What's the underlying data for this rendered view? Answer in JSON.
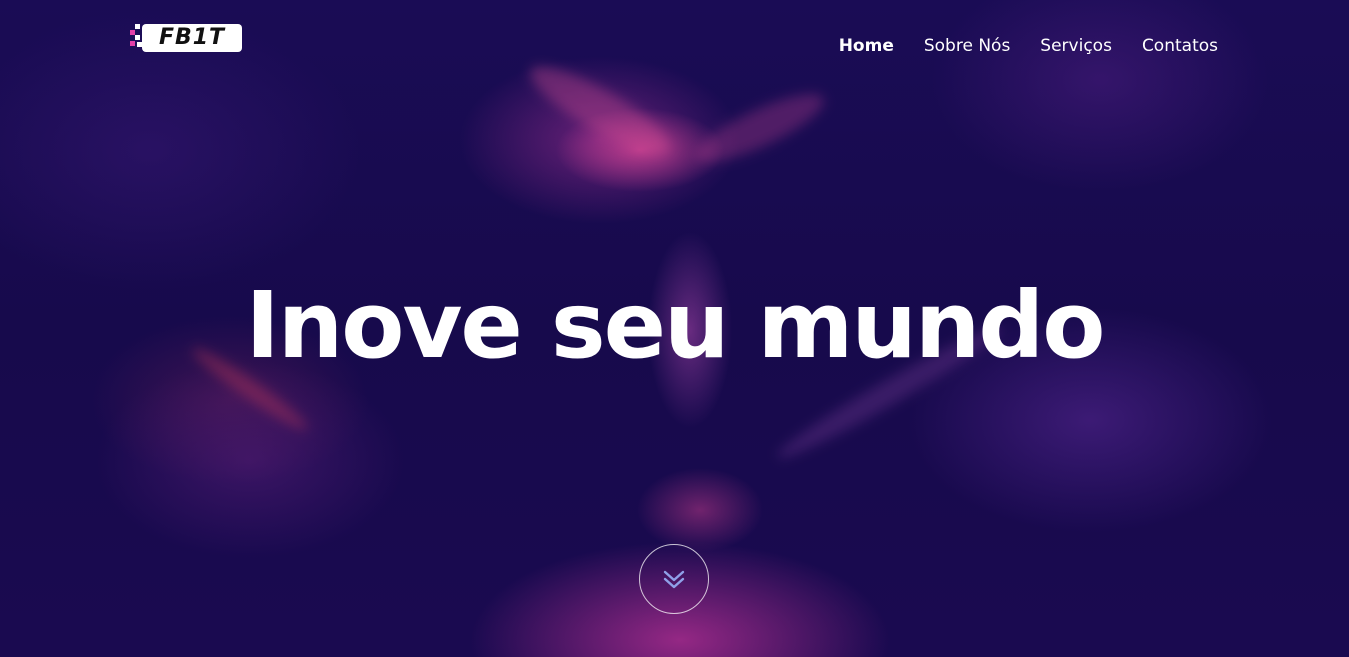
{
  "brand": {
    "logo_text": "FB1T",
    "accent_color": "#e23fa8"
  },
  "nav": {
    "items": [
      {
        "label": "Home",
        "active": true
      },
      {
        "label": "Sobre Nós",
        "active": false
      },
      {
        "label": "Serviços",
        "active": false
      },
      {
        "label": "Contatos",
        "active": false
      }
    ]
  },
  "hero": {
    "headline": "Inove seu mundo",
    "scroll_icon": "chevron-double-down-icon",
    "background_color": "#170a4c"
  }
}
